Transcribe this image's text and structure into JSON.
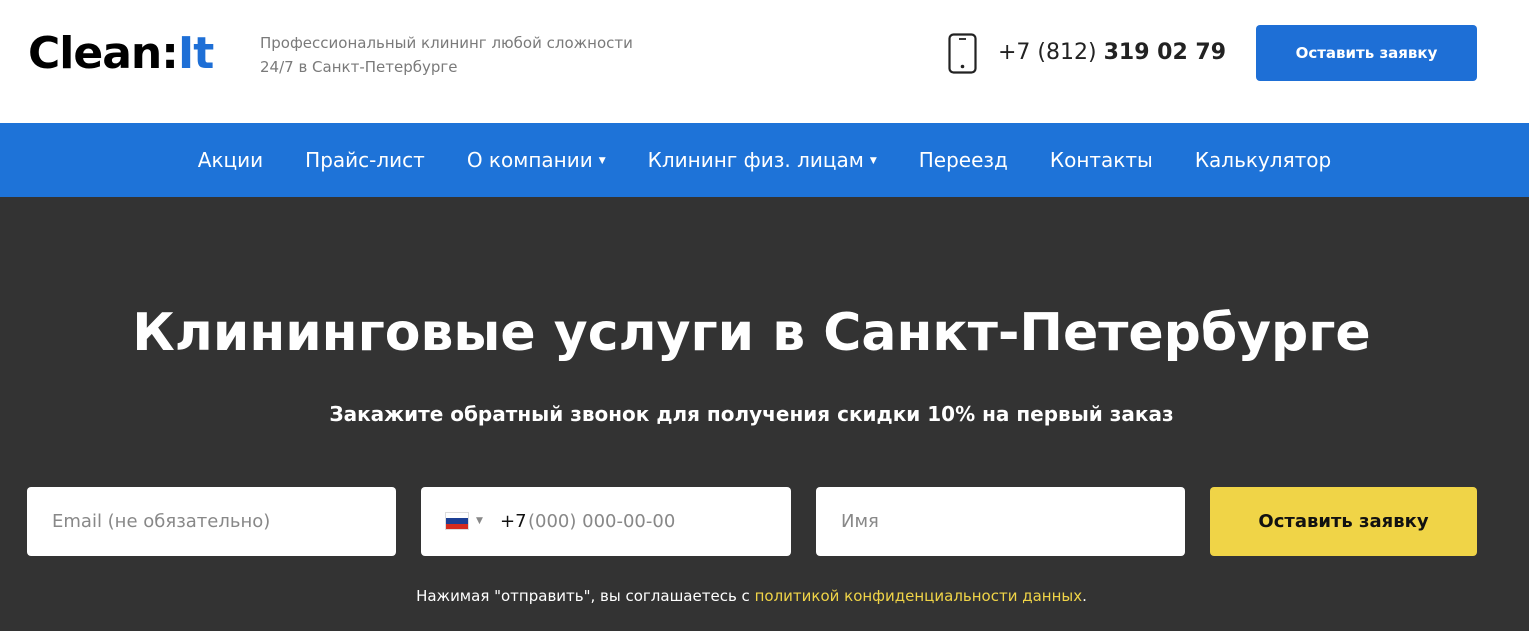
{
  "header": {
    "logo_main": "Clean:",
    "logo_accent": "It",
    "tagline_line1": "Профессиональный клининг любой сложности",
    "tagline_line2": "24/7 в Санкт-Петербурге",
    "phone_prefix": "+7 (812) ",
    "phone_main": "319 02 79",
    "cta_label": "Оставить заявку"
  },
  "nav": {
    "items": [
      {
        "label": "Акции",
        "dropdown": false
      },
      {
        "label": "Прайс-лист",
        "dropdown": false
      },
      {
        "label": "О компании",
        "dropdown": true
      },
      {
        "label": "Клининг физ. лицам",
        "dropdown": true
      },
      {
        "label": "Переезд",
        "dropdown": false
      },
      {
        "label": "Контакты",
        "dropdown": false
      },
      {
        "label": "Калькулятор",
        "dropdown": false
      }
    ],
    "caret": "▼"
  },
  "hero": {
    "title": "Клининговые услуги в Санкт-Петербурге",
    "subtitle": "Закажите обратный звонок для получения скидки 10% на первый заказ"
  },
  "form": {
    "email_placeholder": "Email (не обязательно)",
    "phone_code": "+7",
    "phone_placeholder": "(000) 000-00-00",
    "name_placeholder": "Имя",
    "submit_label": "Оставить заявку",
    "flag_caret": "▼"
  },
  "consent": {
    "text_before": "Нажимая \"отправить\", вы соглашаетесь с ",
    "link_text": "политикой конфиденциальности данных",
    "text_after": "."
  },
  "colors": {
    "brand_blue": "#1e73d8",
    "accent_yellow": "#f0d447",
    "hero_bg": "#333333"
  },
  "icons": {
    "phone": "smartphone-icon",
    "flag": "russia-flag-icon"
  }
}
